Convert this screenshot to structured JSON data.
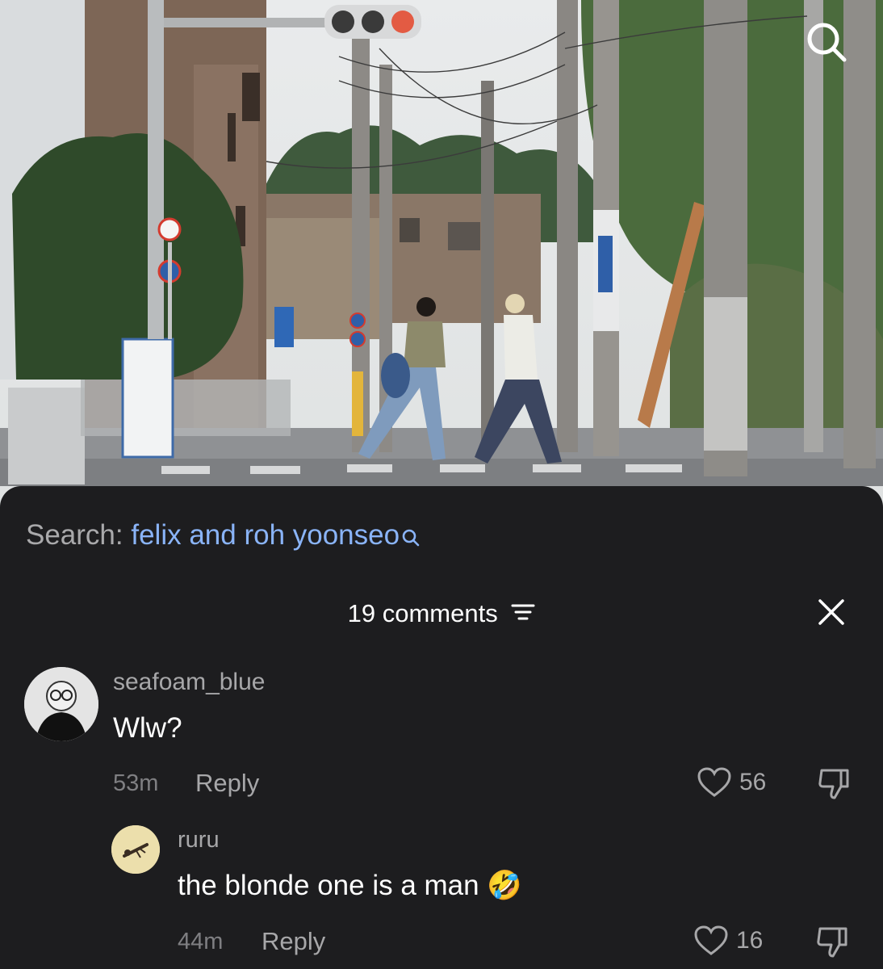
{
  "video": {
    "search_icon": "search-icon"
  },
  "search": {
    "prefix": "Search: ",
    "term": "felix and roh yoonseo",
    "icon": "search-icon"
  },
  "comments_header": {
    "title": "19 comments",
    "sort_icon": "sort-icon",
    "close_icon": "close-icon"
  },
  "comments": [
    {
      "username": "seafoam_blue",
      "text": "Wlw?",
      "time": "53m",
      "reply_label": "Reply",
      "likes": "56"
    }
  ],
  "replies": [
    {
      "username": "ruru",
      "text": "the blonde one is a man",
      "emoji": "🤣",
      "time": "44m",
      "reply_label": "Reply",
      "likes": "16"
    }
  ],
  "colors": {
    "sheet_bg": "#1d1d1f",
    "link": "#8ab4f8",
    "muted": "#a7a7a9"
  }
}
